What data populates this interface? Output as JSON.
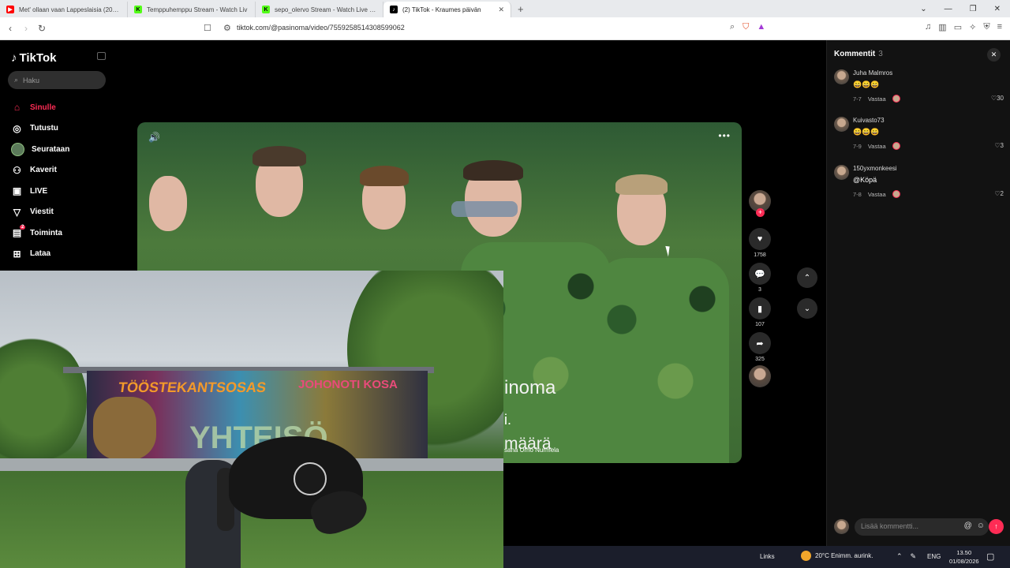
{
  "browser": {
    "tabs": [
      {
        "label": "Met' ollaan vaan Lappeslaisia (2007) #",
        "icon": "youtube-icon",
        "color": "#ff0000",
        "active": false
      },
      {
        "label": "Temppuhemppu Stream - Watch Liv",
        "icon": "kick-icon",
        "color": "#53fc18",
        "active": false
      },
      {
        "label": "sepo_olervo Stream - Watch Live on",
        "icon": "kick-icon",
        "color": "#53fc18",
        "active": false
      },
      {
        "label": "(2) TikTok - Kraumes päivän",
        "icon": "tiktok-icon",
        "color": "#000000",
        "active": true
      }
    ],
    "new_tab": "+",
    "url": "tiktok.com/@pasinoma/video/7559258514308599062"
  },
  "sidebar": {
    "logo": "TikTok",
    "search_placeholder": "Haku",
    "items": [
      {
        "label": "Sinulle",
        "icon": "home-icon",
        "active": true
      },
      {
        "label": "Tutustu",
        "icon": "compass-icon",
        "active": false
      },
      {
        "label": "Seurataan",
        "icon": "avatar-icon",
        "active": false
      },
      {
        "label": "Kaverit",
        "icon": "friends-icon",
        "active": false
      },
      {
        "label": "LIVE",
        "icon": "live-icon",
        "active": false
      },
      {
        "label": "Viestit",
        "icon": "send-icon",
        "active": false
      },
      {
        "label": "Toiminta",
        "icon": "activity-icon",
        "active": false,
        "badge": "2"
      },
      {
        "label": "Lataa",
        "icon": "upload-icon",
        "active": false
      }
    ]
  },
  "video": {
    "caption_line1": "inoma",
    "caption_line2": "i.",
    "caption_line3": "määrä",
    "caption_credit": "sana Urho Nurmela"
  },
  "actions": {
    "likes": "1758",
    "comments": "3",
    "saves": "107",
    "shares": "325"
  },
  "comments": {
    "title": "Kommentit",
    "count": "3",
    "items": [
      {
        "user": "Juha Malmros",
        "text": "😄😄😄",
        "date": "7-7",
        "reply": "Vastaa",
        "likes": "30"
      },
      {
        "user": "Kuivasto73",
        "text": "😄😄😄",
        "date": "7-9",
        "reply": "Vastaa",
        "likes": "3"
      },
      {
        "user": "150yxmonkeesi",
        "text": "@Köpä",
        "date": "7-8",
        "reply": "Vastaa",
        "likes": "2"
      }
    ],
    "input_placeholder": "Lisää kommentti..."
  },
  "webcam": {
    "graffiti1": "TÖÖSTEKANTSOSAS",
    "graffiti2": "JOHONOTI KOSA",
    "graffiti3": "YHTEISÖ"
  },
  "taskbar": {
    "links": "Links",
    "weather": "20°C  Enimm. aurink.",
    "lang": "ENG",
    "time": "13.50",
    "date": "01/08/2026"
  }
}
